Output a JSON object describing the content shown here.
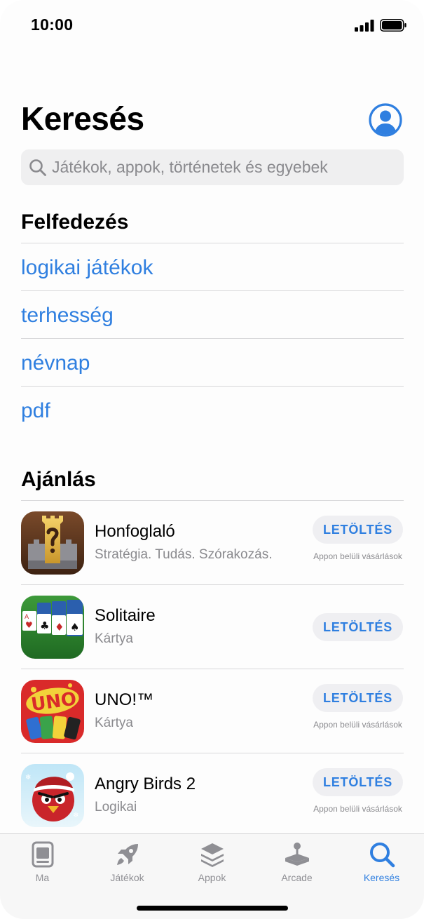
{
  "status_bar": {
    "time": "10:00"
  },
  "header": {
    "title": "Keresés"
  },
  "search": {
    "placeholder": "Játékok, appok, történetek és egyebek"
  },
  "discover": {
    "title": "Felfedezés",
    "items": [
      "logikai játékok",
      "terhesség",
      "névnap",
      "pdf"
    ]
  },
  "suggestions": {
    "title": "Ajánlás",
    "apps": [
      {
        "name": "Honfoglaló",
        "subtitle": "Stratégia. Tudás. Szórakozás.",
        "button": "LETÖLTÉS",
        "note": "Appon belüli vásárlások"
      },
      {
        "name": "Solitaire",
        "subtitle": "Kártya",
        "button": "LETÖLTÉS",
        "note": ""
      },
      {
        "name": "UNO!™",
        "subtitle": "Kártya",
        "button": "LETÖLTÉS",
        "note": "Appon belüli vásárlások"
      },
      {
        "name": "Angry Birds 2",
        "subtitle": "Logikai",
        "button": "LETÖLTÉS",
        "note": "Appon belüli vásárlások"
      }
    ]
  },
  "tab_bar": {
    "tabs": [
      {
        "label": "Ma",
        "icon": "today-icon",
        "active": false
      },
      {
        "label": "Játékok",
        "icon": "rocket-icon",
        "active": false
      },
      {
        "label": "Appok",
        "icon": "apps-stack-icon",
        "active": false
      },
      {
        "label": "Arcade",
        "icon": "joystick-icon",
        "active": false
      },
      {
        "label": "Keresés",
        "icon": "search-icon",
        "active": true
      }
    ]
  },
  "colors": {
    "accent": "#2f7fe0",
    "secondary_text": "#8a8a8e"
  }
}
